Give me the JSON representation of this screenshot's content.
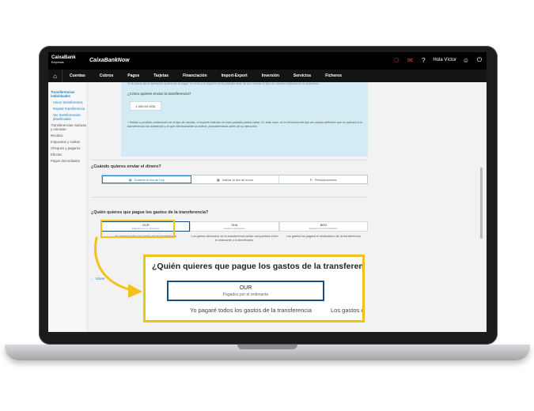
{
  "header": {
    "logo_name": "CaixaBank",
    "logo_sub": "Empresas",
    "brand": "CaixaBankNow",
    "user_name": "Hola Víctor",
    "icons": [
      "bell-icon",
      "mail-icon",
      "help-icon",
      "user-icon",
      "power-icon"
    ]
  },
  "nav": {
    "home_icon": "home-icon",
    "items": [
      "Cuentas",
      "Cobros",
      "Pagos",
      "Tarjetas",
      "Financiación",
      "Import-Export",
      "Inversión",
      "Servicios",
      "Ficheros"
    ]
  },
  "sidebar": {
    "section": "Transferencias individuales",
    "subitems": [
      "Hacer transferencia",
      "Repetir transferencia",
      "Ver transferencias planificadas"
    ],
    "items": [
      "Transferencias masivas y nóminas",
      "Recibos",
      "Impuestos y multas",
      "Cheques y pagarés",
      "Efectos",
      "Pagos domiciliados"
    ]
  },
  "panel": {
    "top_text": "Si el precio de la operación podrá ser al pagar el envío y el importe en la pantalla ante de que acepte el tipo de cambio indicado en la operación.",
    "question": "¿Cómo quieres enviar la transferencia?",
    "amount": "1.000,00 USD",
    "note": "* Debido a posibles variaciones en el tipo de cambio, el importe indicado en esta pantalla podría variar. En todo caso, se le informará del tipo de cambio definitivo que se aplicará a la transferencia con antelación y el que efectivamente la ordene, probablemente antes de su ejecución."
  },
  "when": {
    "question": "¿Cuándo quieres enviar el dinero?",
    "options": [
      "Durante el día de hoy",
      "Indicar el día de envío",
      "Periódicamente"
    ]
  },
  "who": {
    "question": "¿Quién quieres que pague los gastos de la transferencia?",
    "options": [
      {
        "title": "OUR",
        "subtitle": "Pagados por el ordenante"
      },
      {
        "title": "SHA",
        "subtitle": "Gastos compartidos"
      },
      {
        "title": "BEN",
        "subtitle": "Pagados por el beneficiario"
      }
    ],
    "descriptions": [
      "Yo pagaré todos los gastos de la transferencia",
      "Los gastos derivados de la transferencia serán compartidos entre el ordenante y el beneficiario.",
      "Los gastos los pagará el destinatario de la transferencia"
    ]
  },
  "back_link": "← Volver",
  "callout": {
    "question": "¿Quién quieres que pague los gastos de la transferencia?",
    "option_title": "OUR",
    "option_subtitle": "Pagados por el ordenante",
    "description": "Yo pagaré todos los gastos de la transferencia",
    "description_cut": "Los gastos d"
  },
  "colors": {
    "accent": "#1b7fc1",
    "highlight": "#f2c21b",
    "dark": "#000000"
  }
}
